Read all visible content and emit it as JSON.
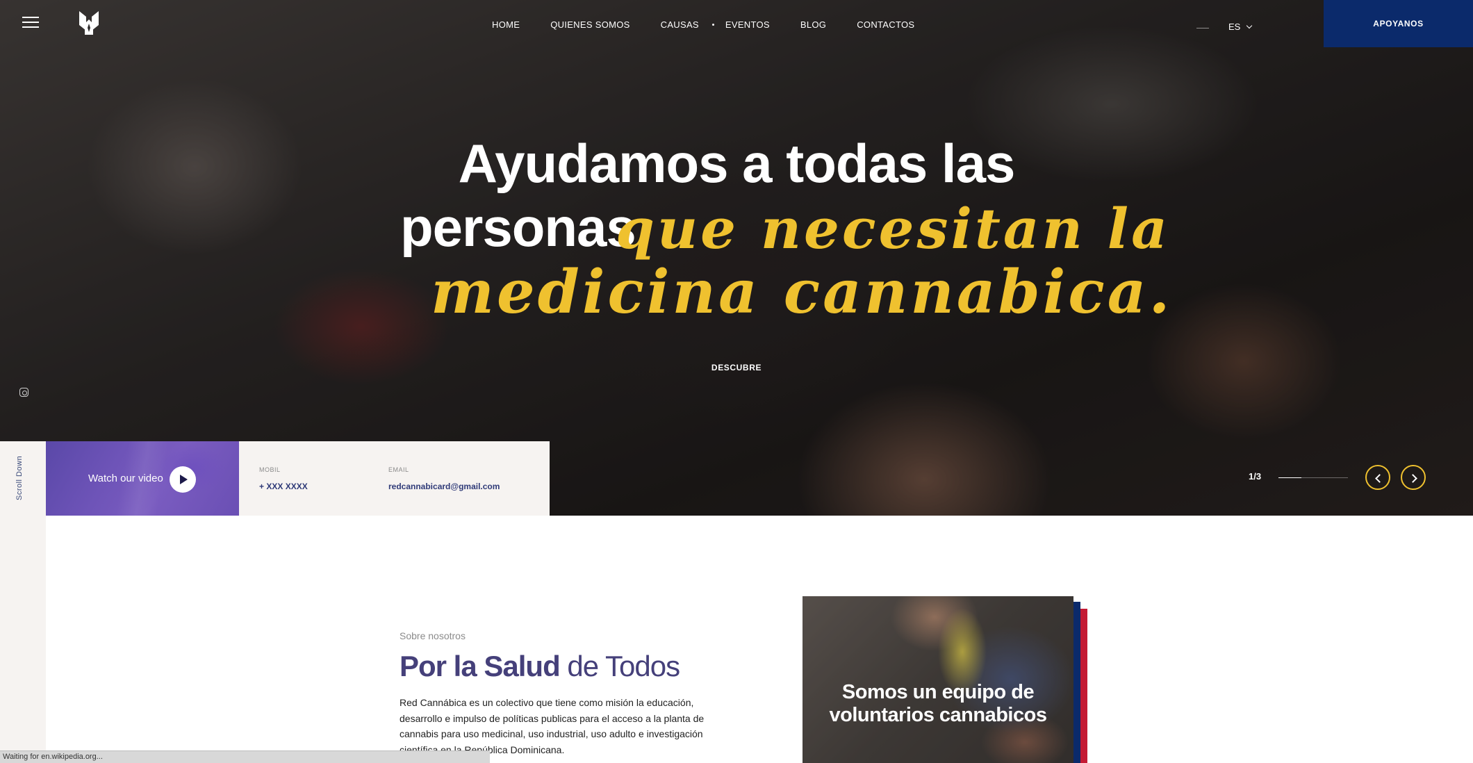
{
  "nav": {
    "items": [
      "HOME",
      "QUIENES SOMOS",
      "CAUSAS",
      "EVENTOS",
      "BLOG",
      "CONTACTOS"
    ],
    "language": "ES",
    "cta": "APOYANOS"
  },
  "hero": {
    "headline_line1": "Ayudamos a todas las",
    "headline_line2": "personas",
    "script_line1": "que necesitan la",
    "script_line2": "medicina cannabica.",
    "discover": "DESCUBRE",
    "slide_counter": "1/3",
    "slide_progress": 0.33,
    "accent_color": "#efc12f"
  },
  "sidebar": {
    "scroll_label": "Scroll Down",
    "social_icon": "instagram-icon"
  },
  "info_bar": {
    "video_label": "Watch our video",
    "phone_label": "MOBIL",
    "phone_value": "+ XXX XXXX",
    "email_label": "EMAIL",
    "email_value": "redcannabicard@gmail.com"
  },
  "about": {
    "kicker": "Sobre nosotros",
    "title_bold": "Por la Salud",
    "title_light": "de Todos",
    "body": "Red Cannábica es un colectivo que tiene como misión la educación, desarrollo e impulso de políticas publicas para el acceso a la planta de cannabis para uso medicinal, uso industrial, uso adulto e investigación científica en la República Dominicana.",
    "card_text": "Somos un equipo de voluntarios cannabicos"
  },
  "status_bar": {
    "text": "Waiting for en.wikipedia.org..."
  },
  "colors": {
    "brand_blue": "#0b2a6b",
    "brand_red": "#c41a34",
    "title_purple": "#45407a"
  }
}
